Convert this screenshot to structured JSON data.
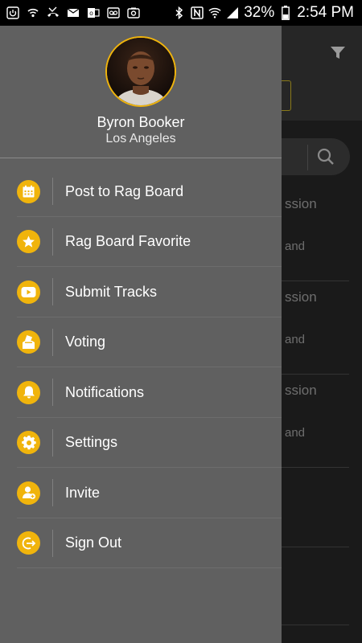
{
  "status_bar": {
    "battery_percent": "32%",
    "time": "2:54 PM",
    "left_icons": [
      "power-icon",
      "wifi-call-icon",
      "missed-call-icon",
      "email-icon",
      "outlook-icon",
      "voicemail-icon",
      "photo-icon"
    ],
    "right_icons": [
      "bluetooth-icon",
      "nfc-icon",
      "wifi-icon",
      "signal-icon",
      "battery-icon"
    ]
  },
  "profile": {
    "name": "Byron Booker",
    "city": "Los Angeles"
  },
  "menu": {
    "items": [
      {
        "label": "Post to Rag Board",
        "icon": "calendar-icon"
      },
      {
        "label": "Rag Board Favorite",
        "icon": "star-icon"
      },
      {
        "label": "Submit Tracks",
        "icon": "youtube-icon"
      },
      {
        "label": "Voting",
        "icon": "ballot-box-icon"
      },
      {
        "label": "Notifications",
        "icon": "bell-icon"
      },
      {
        "label": "Settings",
        "icon": "gear-icon"
      },
      {
        "label": "Invite",
        "icon": "add-user-icon"
      },
      {
        "label": "Sign Out",
        "icon": "sign-out-icon"
      }
    ]
  },
  "background_content": {
    "snippets": [
      "ssion",
      "and",
      "ssion",
      "and",
      "ssion",
      "and"
    ]
  },
  "colors": {
    "accent": "#f0b40c",
    "drawer_bg": "#606060",
    "app_bg": "#1a1a1a"
  }
}
